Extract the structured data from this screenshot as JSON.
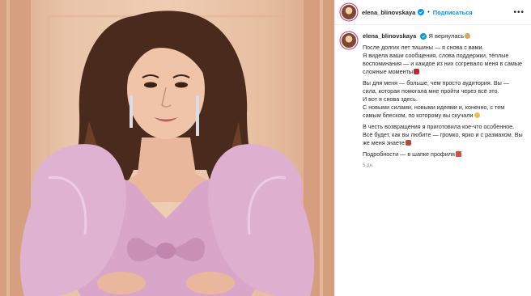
{
  "post": {
    "username": "elena_blinovskaya",
    "follow_label": "Подписаться",
    "more_label": "•••",
    "caption_head": "Я вернулась",
    "paragraph1": "После долгих лет тишины — я снова с вами.\nЯ видела ваши сообщения, слова поддержки, тёплые воспоминания — и каждое из них согревало меня в самые сложные моменты",
    "paragraph2": "Вы для меня — больше, чем просто аудитория. Вы — сила, которая помогала мне пройти через всё это.\nИ вот я снова здесь.\nС новыми силами, новыми идеями и, конечно, с тем самым блеском, по которому вы скучали",
    "paragraph3": "В честь возвращения я приготовила кое-что особенное.\nВсё будет, как вы любите — громко, ярко и с размахом. Вы же меня знаете",
    "paragraph4": "Подробности — в шапке профиля",
    "time_ago": "5 дн."
  },
  "colors": {
    "accent_blue": "#0095f6",
    "text_dark": "#262626",
    "text_muted": "#8e8e8e",
    "dress_pink": "#d9a6c9"
  },
  "icons": [
    "verified-badge-icon",
    "more-options-icon"
  ]
}
